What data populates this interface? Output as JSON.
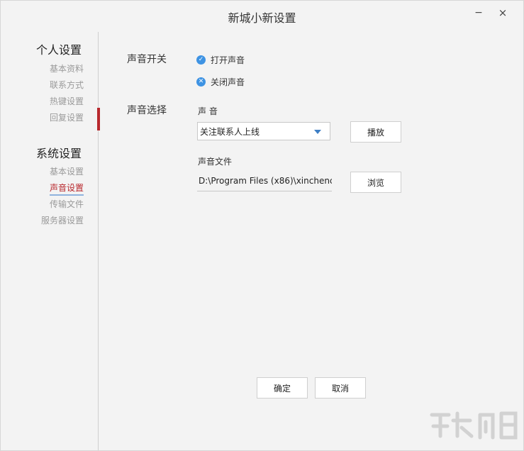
{
  "window": {
    "title": "新城小新设置",
    "minimize_glyph": "−",
    "close_glyph": "×"
  },
  "sidebar": {
    "groups": [
      {
        "title": "个人设置",
        "items": [
          "基本资料",
          "联系方式",
          "热键设置",
          "回复设置"
        ]
      },
      {
        "title": "系统设置",
        "items": [
          "基本设置",
          "声音设置",
          "传输文件",
          "服务器设置"
        ]
      }
    ],
    "active_item": "声音设置"
  },
  "sound_switch": {
    "label": "声音开关",
    "options": [
      {
        "label": "打开声音",
        "icon": "check-icon",
        "glyph": "✓"
      },
      {
        "label": "关闭声音",
        "icon": "x-icon",
        "glyph": "✕"
      }
    ]
  },
  "sound_select": {
    "label": "声音选择",
    "sound_label": "声 音",
    "sound_value": "关注联系人上线",
    "play_button": "播放",
    "file_label": "声音文件",
    "file_value": "D:\\Program Files (x86)\\xinchenc",
    "browse_button": "浏览"
  },
  "footer": {
    "ok_button": "确定",
    "cancel_button": "取消"
  },
  "colors": {
    "accent_red": "#b8282d",
    "accent_blue": "#3e93e3"
  }
}
